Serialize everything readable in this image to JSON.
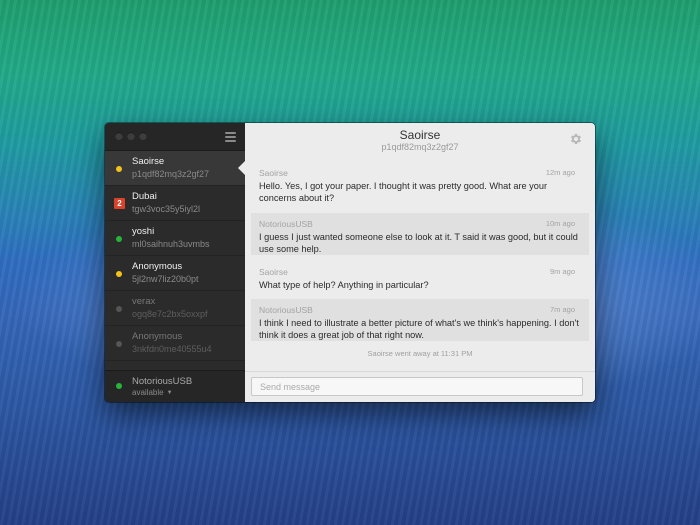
{
  "colors": {
    "online": "#27b43a",
    "away": "#f4c21a",
    "offline": "#555555",
    "badge": "#d8432b"
  },
  "window": {
    "menu_icon": "hamburger-menu-icon",
    "settings_icon": "gear-icon"
  },
  "contacts": [
    {
      "name": "Saoirse",
      "handle": "p1qdf82mq3z2gf27",
      "status": "away",
      "active": true
    },
    {
      "name": "Dubai",
      "handle": "tgw3voc35y5iyl2l",
      "badge": "2"
    },
    {
      "name": "yoshi",
      "handle": "ml0saihnuh3uvmbs",
      "status": "online"
    },
    {
      "name": "Anonymous",
      "handle": "5jl2nw7liz20b0pt",
      "status": "away"
    },
    {
      "name": "verax",
      "handle": "ogq8e7c2bx5oxxpf",
      "status": "offline"
    },
    {
      "name": "Anonymous",
      "handle": "3nkfdn0me40555u4",
      "status": "offline"
    }
  ],
  "self": {
    "name": "NotoriousUSB",
    "status": "available"
  },
  "conversation": {
    "title": "Saoirse",
    "subtitle": "p1qdf82mq3z2gf27",
    "messages": [
      {
        "author": "Saoirse",
        "time": "12m ago",
        "text": "Hello. Yes, I got your paper. I thought it was pretty good. What are your concerns about it?"
      },
      {
        "author": "NotoriousUSB",
        "time": "10m ago",
        "text": "I guess I just wanted someone else to look at it. T said it was good, but it could use some help."
      },
      {
        "author": "Saoirse",
        "time": "9m ago",
        "text": "What type of help? Anything in particular?"
      },
      {
        "author": "NotoriousUSB",
        "time": "7m ago",
        "text": "I think I need to illustrate a better picture of what's we think's happening. I don't think it does a great job of that right now."
      }
    ],
    "system_note": "Saoirse went away at 11:31 PM"
  },
  "composer": {
    "placeholder": "Send message",
    "value": ""
  }
}
